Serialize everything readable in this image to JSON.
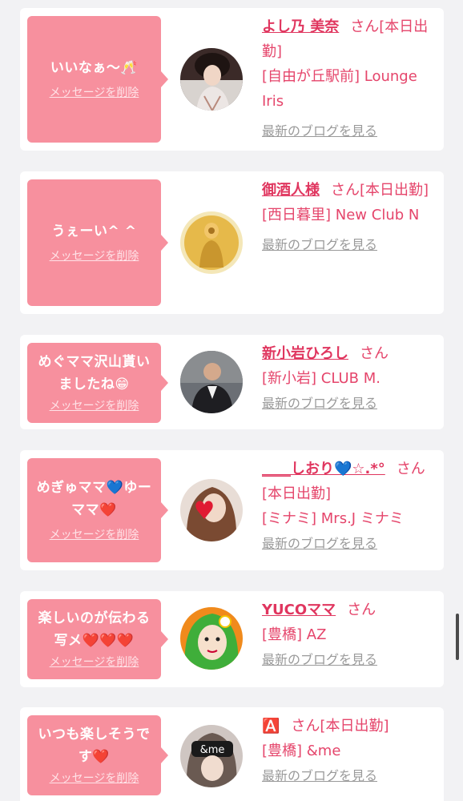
{
  "items": [
    {
      "message_line1": "いいなぁ〜🥂",
      "message_line2": "",
      "delete_label": "メッセージを削除",
      "name": "よし乃 美奈",
      "san": "さん",
      "status": "[本日出勤]",
      "location": "[自由が丘駅前] Lounge Iris",
      "blog_label": "最新のブログを見る"
    },
    {
      "message_line1": "うぇーい^ ^",
      "message_line2": "",
      "delete_label": "メッセージを削除",
      "name": "御酒人様",
      "san": "さん",
      "status": "[本日出勤]",
      "location": "[西日暮里] New Club N",
      "blog_label": "最新のブログを見る"
    },
    {
      "message_line1": "めぐママ沢山貰い",
      "message_line2": "ましたね😁",
      "delete_label": "メッセージを削除",
      "name": "新小岩ひろし",
      "san": "さん",
      "status": "",
      "location": "[新小岩] CLUB M.",
      "blog_label": "最新のブログを見る"
    },
    {
      "message_line1": "めぎゅママ💙ゆー",
      "message_line2": "ママ❤️",
      "delete_label": "メッセージを削除",
      "name": "____しおり💙☆.*°",
      "san": "さん",
      "status": "[本日出勤]",
      "location": "[ミナミ] Mrs.J ミナミ",
      "blog_label": "最新のブログを見る"
    },
    {
      "message_line1": "楽しいのが伝わる",
      "message_line2": "写メ❤️❤️❤️",
      "delete_label": "メッセージを削除",
      "name": "YUCOママ",
      "san": "さん",
      "status": "",
      "location": "[豊橋] AZ",
      "blog_label": "最新のブログを見る"
    },
    {
      "message_line1": "いつも楽しそうで",
      "message_line2": "す❤️",
      "delete_label": "メッセージを削除",
      "name": "🅰️",
      "san": "さん",
      "status": "[本日出勤]",
      "location": "[豊橋] &me",
      "blog_label": "最新のブログを見る"
    }
  ],
  "avatars": [
    {
      "icon": "profile-photo-kimono-woman",
      "bg": "#3b2a28"
    },
    {
      "icon": "profile-photo-golden-buddha",
      "bg": "#e6c25a"
    },
    {
      "icon": "profile-photo-man-suit",
      "bg": "#6b6f75"
    },
    {
      "icon": "profile-photo-woman-heart",
      "bg": "#d9cfc9"
    },
    {
      "icon": "profile-illustration-green-hair",
      "bg": "#f08a1c"
    },
    {
      "icon": "profile-photo-woman-andme",
      "bg": "#4a4a4a"
    }
  ],
  "avatar_overlay_text": "&me"
}
